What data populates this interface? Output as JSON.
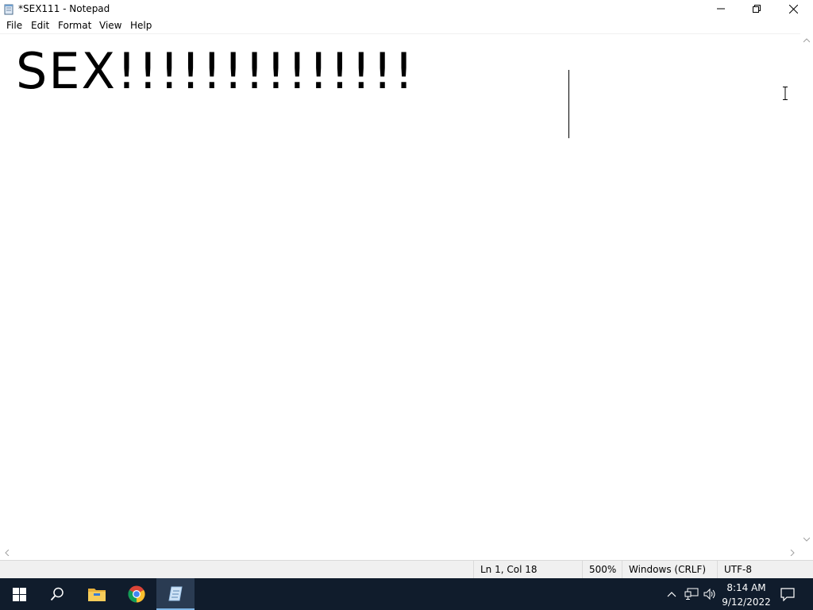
{
  "window": {
    "title": "*SEX111 - Notepad",
    "icons": {
      "app": "notepad-icon",
      "minimize": "minimize-icon",
      "maximize": "restore-icon",
      "close": "close-icon"
    }
  },
  "menu": {
    "items": [
      "File",
      "Edit",
      "Format",
      "View",
      "Help"
    ]
  },
  "editor": {
    "content": "SEX!!!!!!!!!!!!!!"
  },
  "status": {
    "position": "Ln 1, Col 18",
    "zoom": "500%",
    "line_ending": "Windows (CRLF)",
    "encoding": "UTF-8"
  },
  "taskbar": {
    "icons": [
      "start-icon",
      "search-icon",
      "file-explorer-icon",
      "chrome-icon",
      "notepad-icon"
    ],
    "tray_icons": [
      "show-hidden-icons-chevron",
      "network-icon",
      "volume-icon"
    ],
    "time": "8:14 AM",
    "date": "9/12/2022",
    "notifications_icon": "action-center-icon"
  },
  "colors": {
    "taskbar": "#101c2c",
    "statusbar": "#f0f0f0",
    "active_task": "#2a3b52"
  }
}
